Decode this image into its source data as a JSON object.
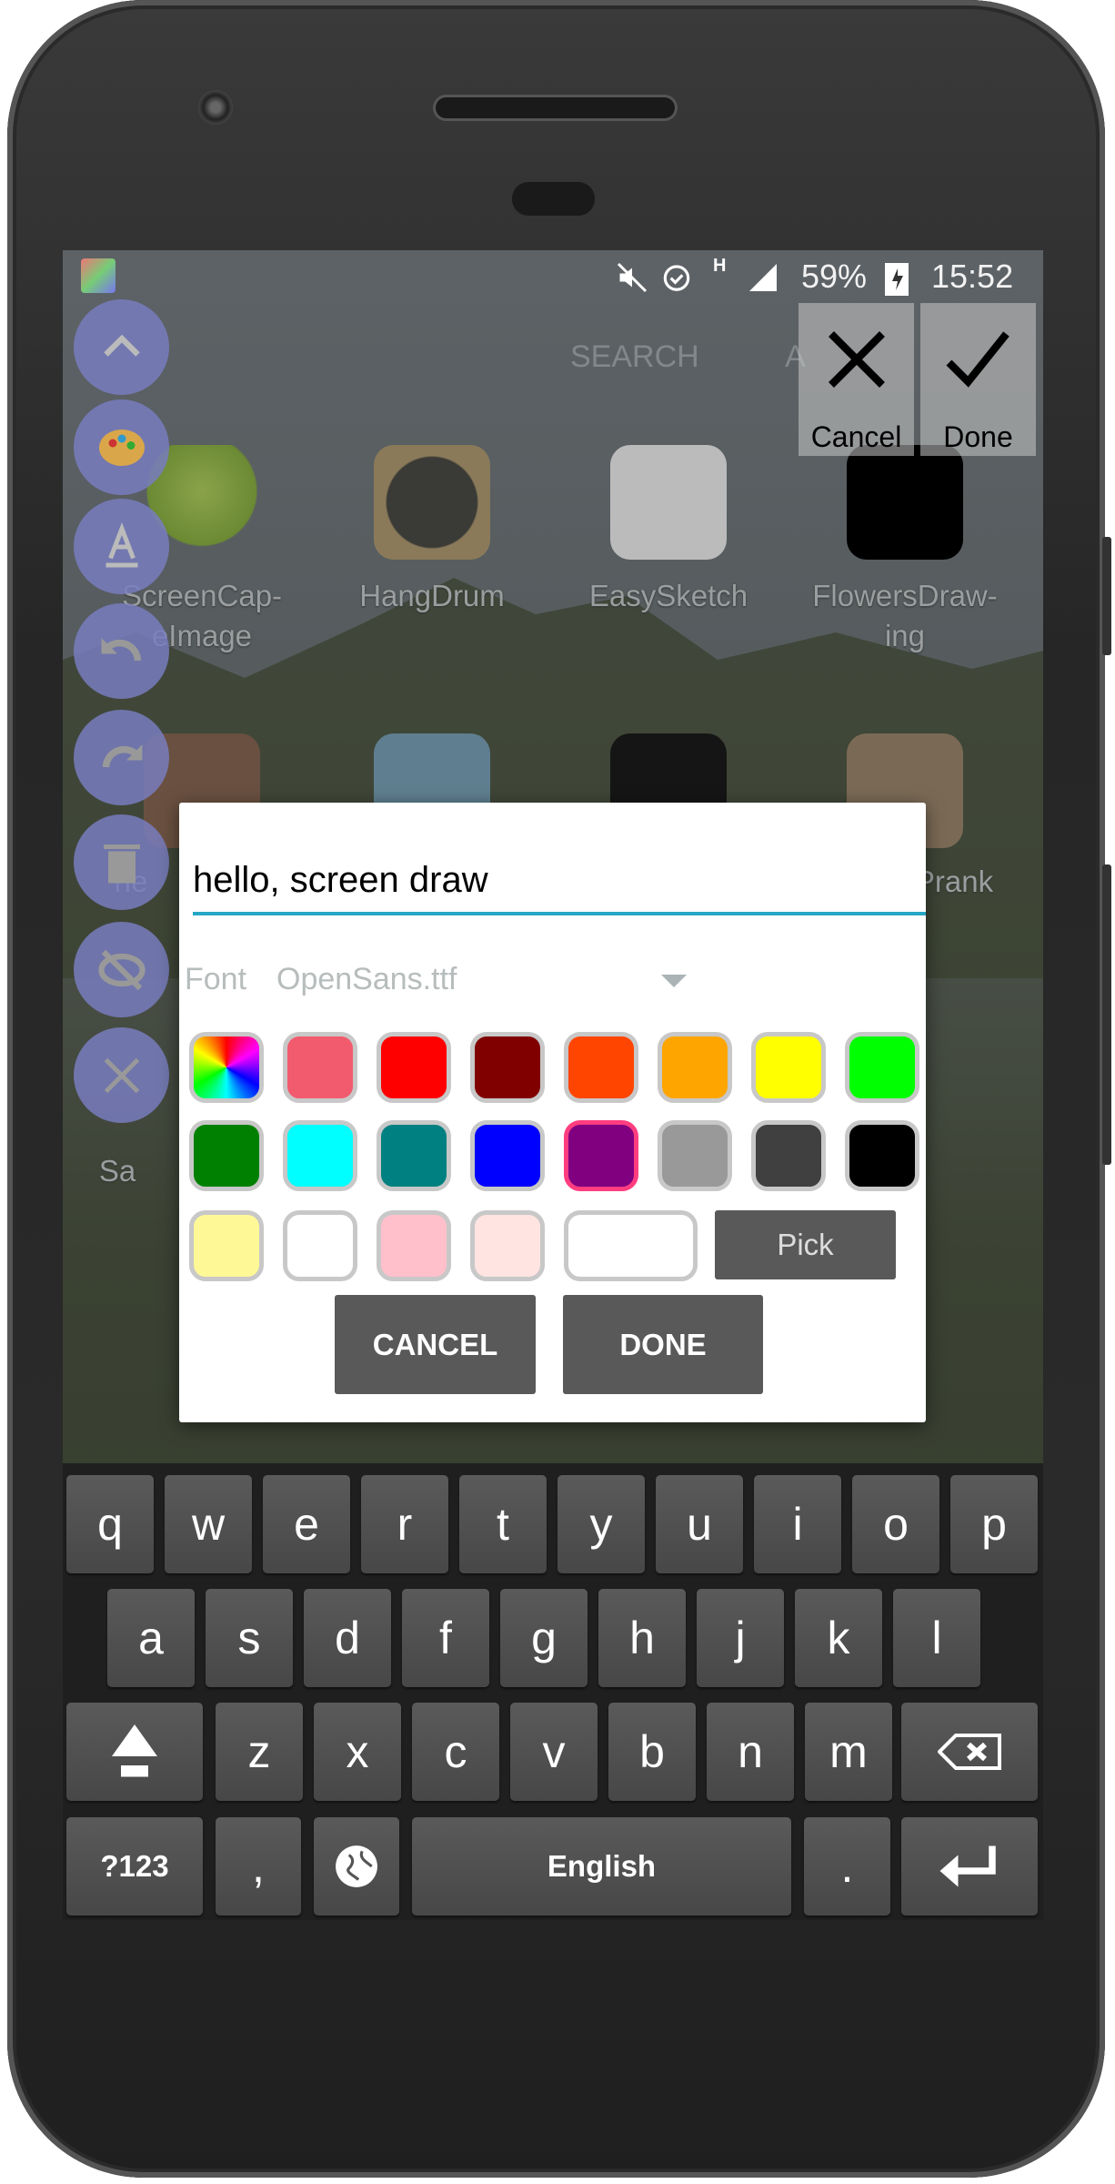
{
  "status_bar": {
    "icons": [
      "app-icon-draw",
      "mute-icon",
      "alarm-icon",
      "network-h-icon",
      "signal-icon",
      "battery-charging-icon"
    ],
    "network_type": "H",
    "battery": "59%",
    "time": "15:52"
  },
  "launcher": {
    "tabs": [
      "SEARCH",
      "A"
    ],
    "apps_row1": [
      {
        "label": "ScreenCap-\neImage"
      },
      {
        "label": "HangDrum"
      },
      {
        "label": "EasySketch"
      },
      {
        "label": "FlowersDraw-\ning"
      }
    ],
    "partial_labels": [
      "ne",
      "Prank",
      "Sa"
    ]
  },
  "toolbar": {
    "buttons": [
      "chevron-up-icon",
      "palette-icon",
      "text-icon",
      "undo-icon",
      "redo-icon",
      "trash-icon",
      "hide-eye-icon",
      "close-icon"
    ]
  },
  "top_actions": {
    "cancel": "Cancel",
    "done": "Done"
  },
  "dialog": {
    "text_value": "hello, screen draw",
    "font_label": "Font",
    "font_value": "OpenSans.ttf",
    "swatches": [
      [
        "rainbow",
        "#f25a6e",
        "#ff0000",
        "#800000",
        "#ff4500",
        "#ffa500",
        "#ffff00",
        "#00ff00"
      ],
      [
        "#008000",
        "#00ffff",
        "#008080",
        "#0000ff",
        "#800080",
        "#999999",
        "#404040",
        "#000000"
      ],
      [
        "#fff897",
        "#ffffff",
        "#ffc0cb",
        "#ffe4e1",
        "#ffffff"
      ]
    ],
    "selected_color": "#800080",
    "selected_border": "#ff3d7f",
    "accent": "#26a6c4",
    "pick_label": "Pick",
    "cancel_label": "CANCEL",
    "done_label": "DONE"
  },
  "keyboard": {
    "row1": [
      "q",
      "w",
      "e",
      "r",
      "t",
      "y",
      "u",
      "i",
      "o",
      "p"
    ],
    "row2": [
      "a",
      "s",
      "d",
      "f",
      "g",
      "h",
      "j",
      "k",
      "l"
    ],
    "row3": [
      "z",
      "x",
      "c",
      "v",
      "b",
      "n",
      "m"
    ],
    "symbols_label": "?123",
    "comma": ",",
    "space_label": "English",
    "period": "."
  }
}
